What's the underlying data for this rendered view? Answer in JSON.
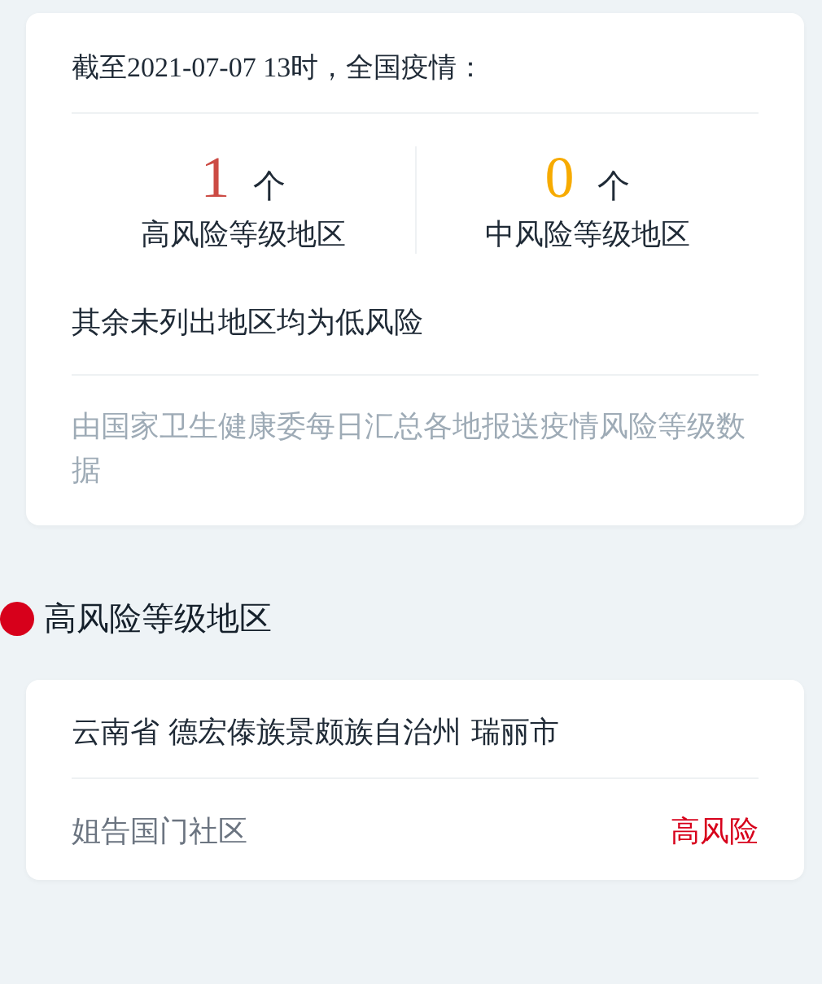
{
  "summary": {
    "heading": "截至2021-07-07 13时，全国疫情：",
    "stats": [
      {
        "count": "1",
        "unit": "个",
        "label": "高风险等级地区",
        "color": "#cc4b44"
      },
      {
        "count": "0",
        "unit": "个",
        "label": "中风险等级地区",
        "color": "#f7ab00"
      }
    ],
    "note": "其余未列出地区均为低风险",
    "source": "由国家卫生健康委每日汇总各地报送疫情风险等级数据"
  },
  "sections": [
    {
      "title": "高风险等级地区",
      "color": "#d7001b",
      "regions": [
        {
          "name": "云南省 德宏傣族景颇族自治州 瑞丽市",
          "areas": [
            {
              "name": "姐告国门社区",
              "level": "高风险"
            }
          ]
        }
      ]
    }
  ]
}
